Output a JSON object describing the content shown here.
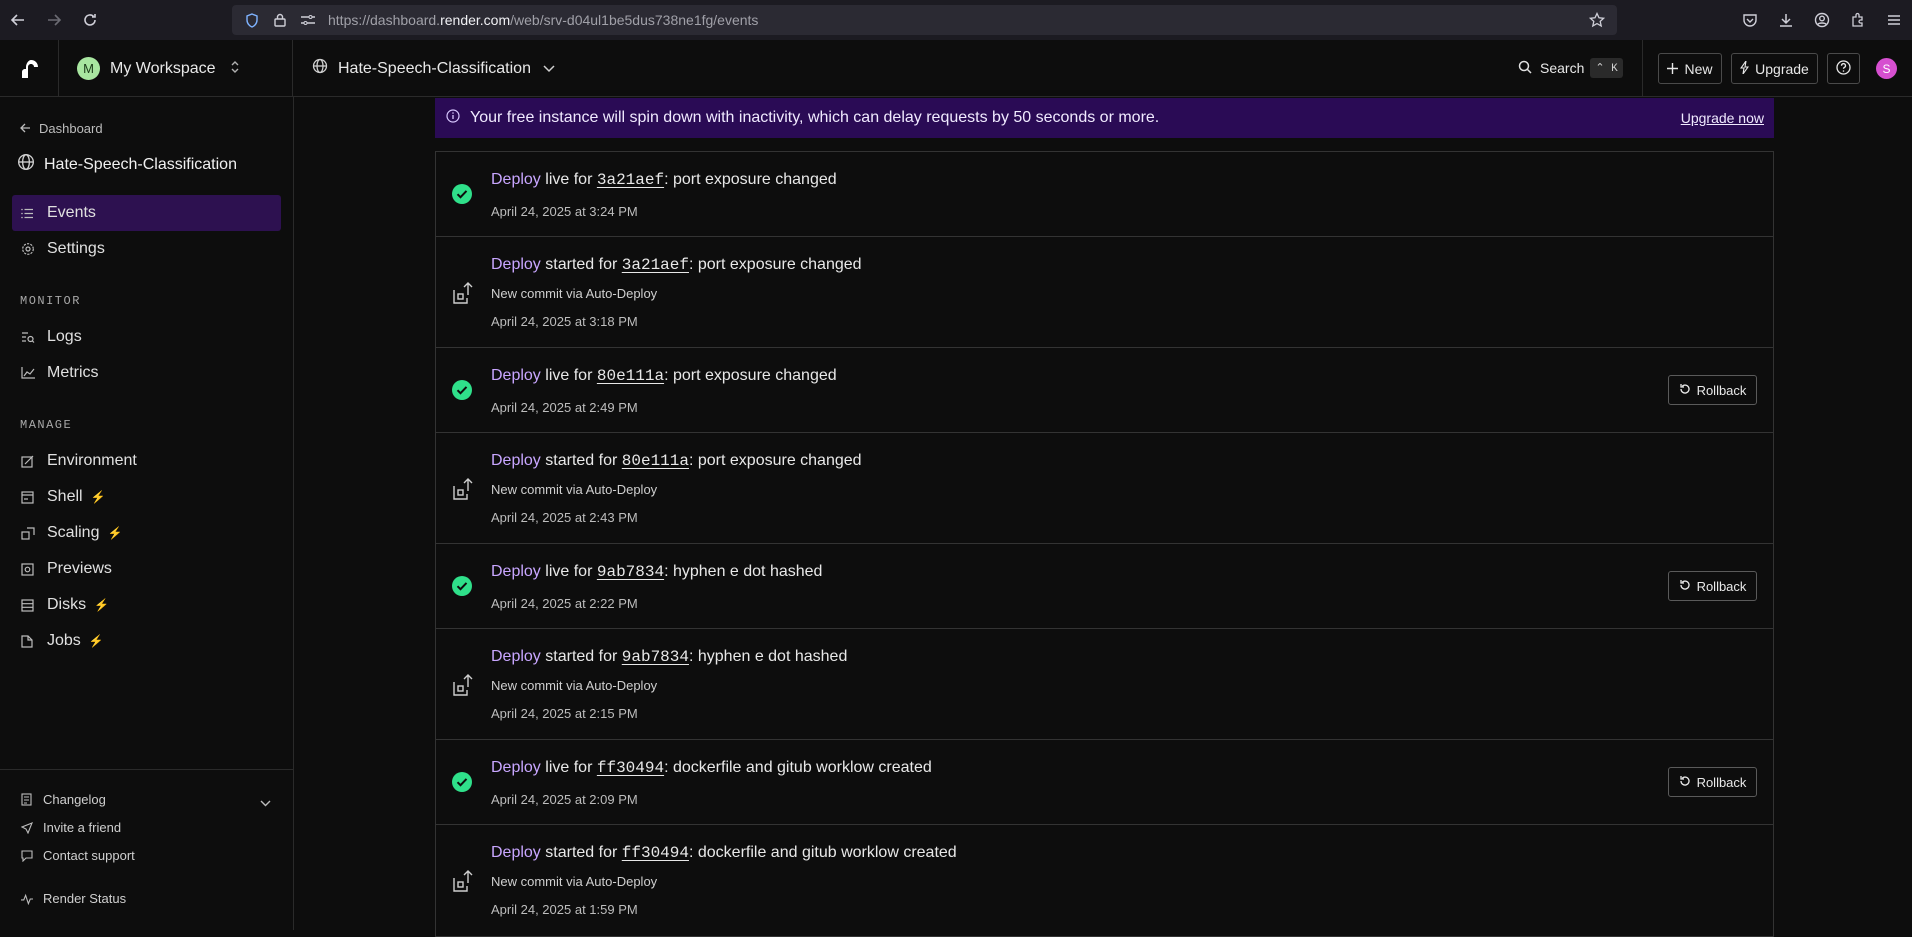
{
  "browser": {
    "url_prefix": "https://dashboard.",
    "url_domain": "render.com",
    "url_path": "/web/srv-d04ul1be5dus738ne1fg/events"
  },
  "header": {
    "workspace_initial": "M",
    "workspace_name": "My Workspace",
    "service_name": "Hate-Speech-Classification",
    "search_label": "Search",
    "search_shortcut": "⌃ K",
    "new_label": "New",
    "upgrade_label": "Upgrade",
    "help_label": "?",
    "user_initial": "S"
  },
  "sidebar": {
    "back_label": "Dashboard",
    "service_title": "Hate-Speech-Classification",
    "items": [
      {
        "label": "Events"
      },
      {
        "label": "Settings"
      }
    ],
    "monitor_label": "MONITOR",
    "monitor_items": [
      {
        "label": "Logs"
      },
      {
        "label": "Metrics"
      }
    ],
    "manage_label": "MANAGE",
    "manage_items": [
      {
        "label": "Environment"
      },
      {
        "label": "Shell"
      },
      {
        "label": "Scaling"
      },
      {
        "label": "Previews"
      },
      {
        "label": "Disks"
      },
      {
        "label": "Jobs"
      }
    ],
    "footer": {
      "changelog": "Changelog",
      "invite": "Invite a friend",
      "support": "Contact support",
      "status": "Render Status"
    }
  },
  "banner": {
    "text": "Your free instance will spin down with inactivity, which can delay requests by 50 seconds or more.",
    "link": "Upgrade now"
  },
  "events": [
    {
      "type": "live",
      "deploy": "Deploy",
      "verb": "live",
      "for": "for",
      "commit": "3a21aef",
      "message": ": port exposure changed",
      "time": "April 24, 2025 at 3:24 PM",
      "rollback": ""
    },
    {
      "type": "started",
      "deploy": "Deploy",
      "verb": "started",
      "for": "for",
      "commit": "3a21aef",
      "message": ": port exposure changed",
      "sub": "New commit via Auto-Deploy",
      "time": "April 24, 2025 at 3:18 PM"
    },
    {
      "type": "live",
      "deploy": "Deploy",
      "verb": "live",
      "for": "for",
      "commit": "80e111a",
      "message": ": port exposure changed",
      "time": "April 24, 2025 at 2:49 PM",
      "rollback": "Rollback"
    },
    {
      "type": "started",
      "deploy": "Deploy",
      "verb": "started",
      "for": "for",
      "commit": "80e111a",
      "message": ": port exposure changed",
      "sub": "New commit via Auto-Deploy",
      "time": "April 24, 2025 at 2:43 PM"
    },
    {
      "type": "live",
      "deploy": "Deploy",
      "verb": "live",
      "for": "for",
      "commit": "9ab7834",
      "message": ": hyphen e dot hashed",
      "time": "April 24, 2025 at 2:22 PM",
      "rollback": "Rollback"
    },
    {
      "type": "started",
      "deploy": "Deploy",
      "verb": "started",
      "for": "for",
      "commit": "9ab7834",
      "message": ": hyphen e dot hashed",
      "sub": "New commit via Auto-Deploy",
      "time": "April 24, 2025 at 2:15 PM"
    },
    {
      "type": "live",
      "deploy": "Deploy",
      "verb": "live",
      "for": "for",
      "commit": "ff30494",
      "message": ": dockerfile and gitub worklow created",
      "time": "April 24, 2025 at 2:09 PM",
      "rollback": "Rollback"
    },
    {
      "type": "started",
      "deploy": "Deploy",
      "verb": "started",
      "for": "for",
      "commit": "ff30494",
      "message": ": dockerfile and gitub worklow created",
      "sub": "New commit via Auto-Deploy",
      "time": "April 24, 2025 at 1:59 PM"
    }
  ],
  "colors": {
    "accent_purple": "#2d1150",
    "banner_bg": "#2a0b55",
    "deploy_text": "#c8a6ff",
    "success_green": "#2fe08a",
    "bolt": "#c34fe0"
  }
}
